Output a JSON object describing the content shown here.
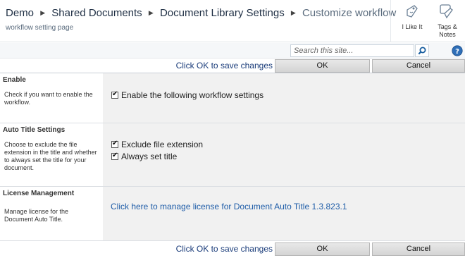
{
  "header": {
    "breadcrumb": [
      "Demo",
      "Shared Documents",
      "Document Library Settings",
      "Customize workflow"
    ],
    "subtitle": "workflow setting page",
    "like_label": "I Like It",
    "tags_label_line1": "Tags &",
    "tags_label_line2": "Notes"
  },
  "search": {
    "placeholder": "Search this site..."
  },
  "toolbar": {
    "message": "Click OK to save changes",
    "ok_label": "OK",
    "cancel_label": "Cancel"
  },
  "sections": [
    {
      "title": "Enable",
      "description": "Check if you want to enable the workflow.",
      "options": [
        "Enable the following workflow settings"
      ]
    },
    {
      "title": "Auto Title Settings",
      "description": "Choose to exclude the file extension in the title and whether to always set the title for your document.",
      "options": [
        "Exclude file extension",
        "Always set title"
      ]
    },
    {
      "title": "License Management",
      "description": "Manage license for the Document Auto Title.",
      "link": "Click here to manage license for Document Auto Title 1.3.823.1"
    }
  ],
  "colors": {
    "link": "#1f5da8",
    "message": "#1a3c7a",
    "panel": "#f1f1f1"
  }
}
